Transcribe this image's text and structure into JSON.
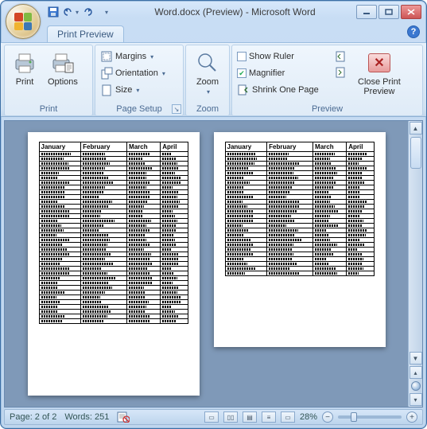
{
  "window": {
    "title": "Word.docx (Preview) - Microsoft Word"
  },
  "tabs": {
    "print_preview": "Print Preview"
  },
  "ribbon": {
    "print": {
      "group_label": "Print",
      "print_btn": "Print",
      "options_btn": "Options"
    },
    "page_setup": {
      "group_label": "Page Setup",
      "margins": "Margins",
      "orientation": "Orientation",
      "size": "Size"
    },
    "zoom": {
      "group_label": "Zoom",
      "zoom_btn": "Zoom"
    },
    "preview": {
      "group_label": "Preview",
      "show_ruler": "Show Ruler",
      "magnifier": "Magnifier",
      "shrink": "Shrink One Page",
      "close_line1": "Close Print",
      "close_line2": "Preview"
    }
  },
  "table_headers": [
    "January",
    "February",
    "March",
    "April"
  ],
  "status": {
    "page": "Page: 2 of 2",
    "words": "Words: 251",
    "zoom_pct": "28%"
  }
}
